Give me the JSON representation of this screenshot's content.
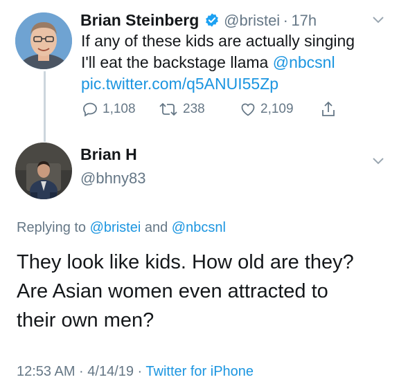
{
  "tweet1": {
    "name": "Brian Steinberg",
    "handle": "@bristei",
    "time_sep": "·",
    "time": "17h",
    "text_line1": "If any of these kids are actually singing",
    "text_line2_prefix": "I'll eat the backstage llama ",
    "mention": "@nbcsnl",
    "link": "pic.twitter.com/q5ANUI55Zp",
    "replies": "1,108",
    "retweets": "238",
    "likes": "2,109"
  },
  "tweet2": {
    "name": "Brian H",
    "handle": "@bhny83",
    "replying_prefix": "Replying to ",
    "replying_user1": "@bristei",
    "replying_and": " and ",
    "replying_user2": "@nbcsnl",
    "text_line1": "They look like kids. How old are they?",
    "text_line2": "Are Asian women even attracted to",
    "text_line3": "their own men?",
    "timestamp": "12:53 AM · 4/14/19 · ",
    "source": "Twitter for iPhone"
  },
  "colors": {
    "link": "#1b95e0",
    "muted": "#657786",
    "verified": "#1da1f2",
    "text": "#14171a"
  }
}
